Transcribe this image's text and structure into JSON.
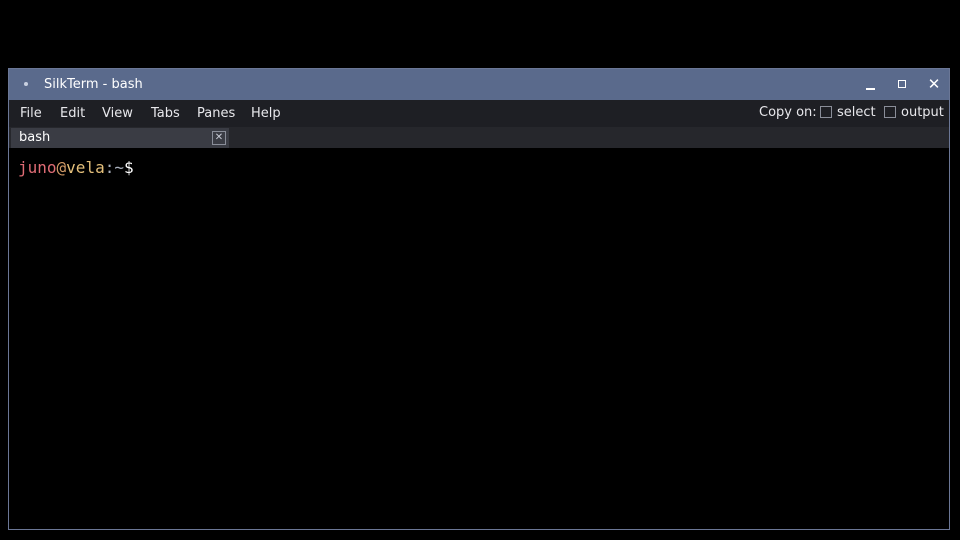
{
  "window": {
    "title": "SilkTerm - bash"
  },
  "menu": {
    "items": [
      "File",
      "Edit",
      "View",
      "Tabs",
      "Panes",
      "Help"
    ]
  },
  "copy_on": {
    "label": "Copy on:",
    "options": [
      {
        "label": "select",
        "checked": false
      },
      {
        "label": "output",
        "checked": false
      }
    ]
  },
  "tabs": [
    {
      "label": "bash"
    }
  ],
  "terminal": {
    "prompt": {
      "user": "juno",
      "at": "@",
      "host": "vela",
      "separator": ":",
      "path": "~",
      "symbol": "$"
    }
  },
  "colors": {
    "titlebar": "#5a6a8c",
    "menubar": "#1e1f24",
    "user": "#e06c75",
    "host": "#e5c07b"
  }
}
